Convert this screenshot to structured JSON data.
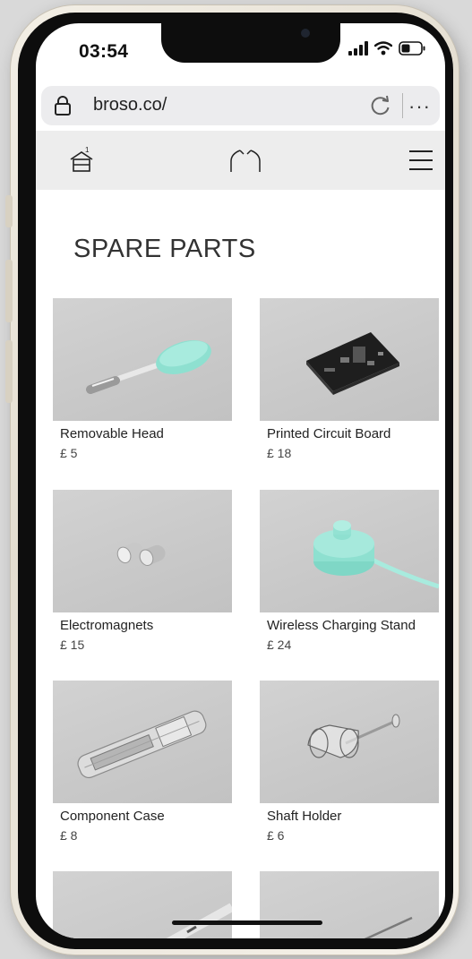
{
  "status_bar": {
    "time": "03:54"
  },
  "browser": {
    "url": "broso.co/",
    "more_label": "···"
  },
  "site_header": {
    "basket_count": "1"
  },
  "page": {
    "title": "SPARE PARTS"
  },
  "products": [
    {
      "name": "Removable Head",
      "price": "£ 5",
      "image": "toothbrush-head"
    },
    {
      "name": "Printed Circuit Board",
      "price": "£ 18",
      "image": "circuit-board"
    },
    {
      "name": "Electromagnets",
      "price": "£ 15",
      "image": "electromagnets"
    },
    {
      "name": "Wireless Charging Stand",
      "price": "£ 24",
      "image": "charging-stand"
    },
    {
      "name": "Component Case",
      "price": "£ 8",
      "image": "component-case"
    },
    {
      "name": "Shaft Holder",
      "price": "£ 6",
      "image": "shaft-holder"
    },
    {
      "name": "",
      "price": "",
      "image": "partial-part-7"
    },
    {
      "name": "",
      "price": "",
      "image": "partial-part-8"
    }
  ],
  "colors": {
    "accent_mint": "#8ee0d0",
    "header_bg": "#ededed",
    "frame_gold": "#e8e2d5"
  }
}
